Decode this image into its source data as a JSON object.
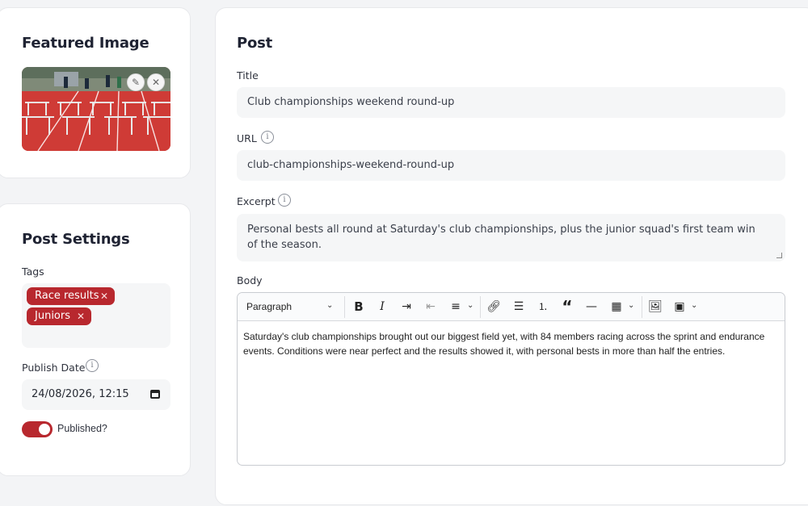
{
  "featured": {
    "title": "Featured Image"
  },
  "settings": {
    "title": "Post Settings",
    "tags_label": "Tags",
    "tags": [
      "Race results",
      "Juniors"
    ],
    "publish_date_label": "Publish Date",
    "publish_date_value": "24/08/2026, 12:15",
    "published_label": "Published?",
    "published": true
  },
  "post": {
    "title": "Post",
    "title_label": "Title",
    "title_value": "Club championships weekend round-up",
    "url_label": "URL",
    "url_value": "club-championships-weekend-round-up",
    "excerpt_label": "Excerpt",
    "excerpt_value": "Personal bests all round at Saturday's club championships, plus the junior squad's first team win of the season.",
    "body_label": "Body",
    "body_format": "Paragraph",
    "body_text": "Saturday's club championships brought out our biggest field yet, with 84 members racing across the sprint and endurance events. Conditions were near perfect and the results showed it, with personal bests in more than half the entries."
  },
  "colors": {
    "accent": "#b8282e",
    "card_bg": "#ffffff",
    "page_bg": "#f3f4f6",
    "input_bg": "#f5f6f7"
  },
  "icons": [
    "info-icon",
    "edit-icon",
    "close-icon",
    "calendar-icon",
    "bold-icon",
    "italic-icon",
    "indent-icon",
    "outdent-icon",
    "align-icon",
    "link-icon",
    "bullet-list-icon",
    "numbered-list-icon",
    "quote-icon",
    "horizontal-rule-icon",
    "table-icon",
    "image-icon",
    "media-icon"
  ]
}
